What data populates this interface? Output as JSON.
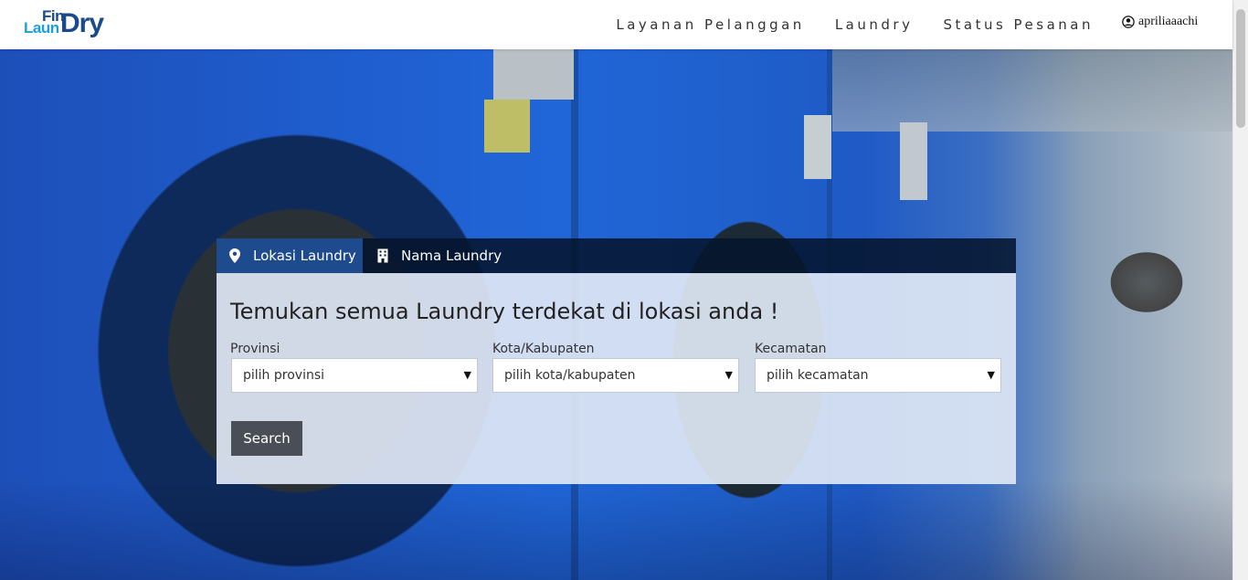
{
  "brand": {
    "logo_fin": "Fin",
    "logo_laun": "Laun",
    "logo_dry": "Dry"
  },
  "nav": {
    "items": [
      {
        "label": "Layanan Pelanggan"
      },
      {
        "label": "Laundry"
      },
      {
        "label": "Status Pesanan"
      }
    ],
    "user_icon": "user-circle-icon",
    "username": "apriliaaachi"
  },
  "search": {
    "tabs": [
      {
        "label": "Lokasi Laundry",
        "icon": "map-marker-icon",
        "active": true
      },
      {
        "label": "Nama Laundry",
        "icon": "building-icon",
        "active": false
      }
    ],
    "heading": "Temukan semua Laundry terdekat di lokasi anda !",
    "fields": [
      {
        "label": "Provinsi",
        "selected": "pilih provinsi"
      },
      {
        "label": "Kota/Kabupaten",
        "selected": "pilih kota/kabupaten"
      },
      {
        "label": "Kecamatan",
        "selected": "pilih kecamatan"
      }
    ],
    "button_label": "Search"
  },
  "colors": {
    "accent": "#1e4a8e",
    "button": "#4a4f57",
    "logo_dark": "#1a4a8a",
    "logo_light": "#1aa0e0"
  }
}
